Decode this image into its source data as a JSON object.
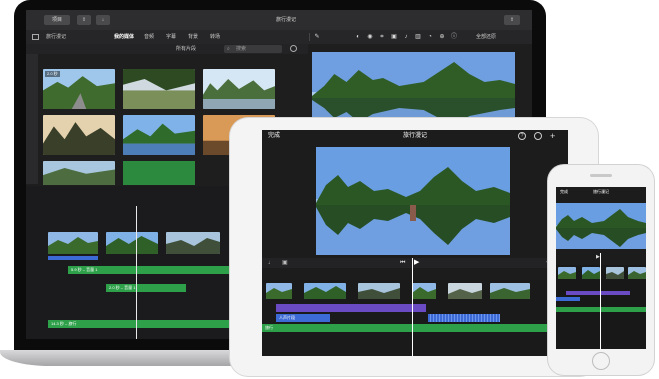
{
  "mac": {
    "window_title": "旅行漫记",
    "back_button": "项目",
    "library_label": "旅行漫记",
    "tabs": [
      "我的媒体",
      "音频",
      "字幕",
      "背景",
      "转场"
    ],
    "filter_label": "所有片段",
    "search_placeholder": "搜索",
    "reset_label": "全部还原",
    "thumb_duration": "2.0 秒",
    "clip_labels": [
      "5.9 秒 – 音量 1",
      "2.0 秒 – 音量 1",
      "14.3 秒 – 旅行"
    ]
  },
  "ipad": {
    "done_label": "完成",
    "title": "旅行漫记",
    "help_icon": "?",
    "add_icon": "+",
    "audio_labels": [
      "旅行",
      "人声片段"
    ]
  },
  "iphone": {
    "done_label": "完成",
    "title": "旅行漫记"
  },
  "colors": {
    "audio_green": "#2fa04a",
    "voice_blue": "#3c6bd6",
    "title_purple": "#6a4bc4",
    "playhead": "#ffffff"
  }
}
